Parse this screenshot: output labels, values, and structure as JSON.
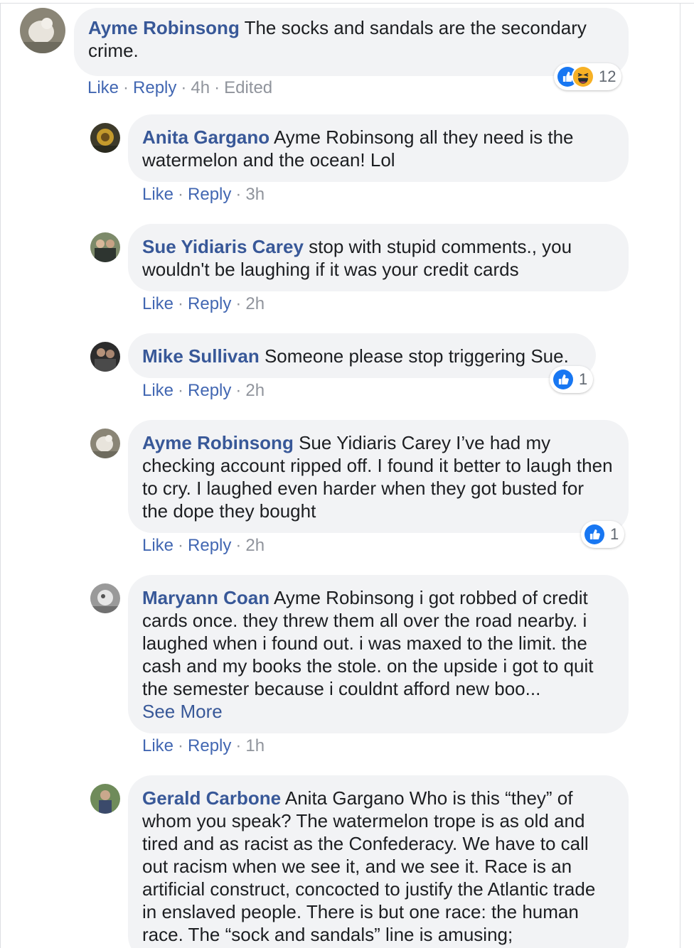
{
  "comments": [
    {
      "name": "Ayme Robinsong",
      "text": "The socks and sandals are the secondary crime.",
      "like": "Like",
      "reply": "Reply",
      "time": "4h",
      "edited": "Edited",
      "reaction_count": "12"
    },
    {
      "name": "Anita Gargano",
      "text": "Ayme Robinsong all they need is the watermelon and the ocean! Lol",
      "like": "Like",
      "reply": "Reply",
      "time": "3h"
    },
    {
      "name": "Sue Yidiaris Carey",
      "text": "stop with stupid comments., you wouldn't be laughing if it was your credit cards",
      "like": "Like",
      "reply": "Reply",
      "time": "2h"
    },
    {
      "name": "Mike Sullivan",
      "text": "Someone please stop triggering Sue.",
      "like": "Like",
      "reply": "Reply",
      "time": "2h",
      "reaction_count": "1"
    },
    {
      "name": "Ayme Robinsong",
      "text": "Sue Yidiaris Carey I’ve had my checking account ripped off. I found it better to laugh then to cry. I laughed even harder when they got busted for the dope they bought",
      "like": "Like",
      "reply": "Reply",
      "time": "2h",
      "reaction_count": "1"
    },
    {
      "name": "Maryann Coan",
      "text": "Ayme Robinsong i got robbed of credit cards once. they threw them all over the road nearby. i laughed when i found out. i was maxed to the limit. the cash and my books the stole. on the upside i got to quit the semester because i couldnt afford new boo...",
      "see_more": "See More",
      "like": "Like",
      "reply": "Reply",
      "time": "1h"
    },
    {
      "name": "Gerald Carbone",
      "text": "Anita Gargano Who is this “they” of whom you speak? The watermelon trope is as old and tired and as racist as the Confederacy. We have to call out racism when we see it, and we see it. Race is an artificial construct, concocted to justify the Atlantic trade in enslaved people. There is but one race: the human race. The “sock and sandals” line is amusing;"
    }
  ],
  "icons": {
    "like": "like-reaction-icon",
    "haha": "haha-reaction-icon"
  },
  "colors": {
    "name": "#385898",
    "link": "#4267b2",
    "bubble": "#f2f3f5",
    "like_blue": "#1877f2",
    "haha_yellow": "#f7b125"
  }
}
